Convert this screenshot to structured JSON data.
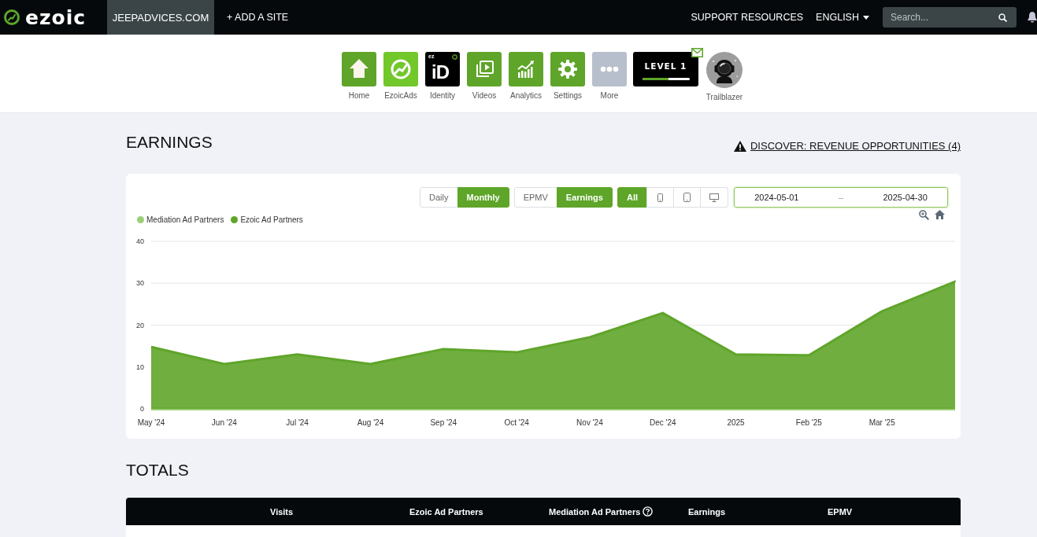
{
  "topbar": {
    "logo": "ezoic",
    "site_tab": {
      "label": "JEEPADVICES.COM",
      "selected": true
    },
    "add_site": "+ ADD A SITE",
    "support": "SUPPORT RESOURCES",
    "language": "ENGLISH",
    "search": {
      "placeholder": "Search..."
    }
  },
  "apps": [
    {
      "kind": "tile",
      "label": "Home"
    },
    {
      "kind": "tile",
      "label": "EzoicAds"
    },
    {
      "kind": "logo_tile",
      "label": "Identity",
      "logo_small": "ez",
      "logo_large": "iD"
    },
    {
      "kind": "tile",
      "label": "Videos"
    },
    {
      "kind": "tile",
      "label": "Analytics"
    },
    {
      "kind": "tile",
      "label": "Settings"
    },
    {
      "kind": "tile",
      "label": "More"
    },
    {
      "kind": "level",
      "title": "LEVEL 1",
      "level": 0.56
    },
    {
      "kind": "avatar",
      "label": "Trailblazer"
    }
  ],
  "earnings": {
    "title": "EARNINGS",
    "discover_link": "DISCOVER: REVENUE OPPORTUNITIES (4)",
    "period_buttons": [
      {
        "label": "Daily",
        "selected": false
      },
      {
        "label": "Monthly",
        "selected": true
      }
    ],
    "metric_buttons": [
      {
        "label": "EPMV",
        "selected": false
      },
      {
        "label": "Earnings",
        "selected": true
      }
    ],
    "device_buttons": [
      {
        "kind": "text",
        "label": "All",
        "selected": true
      },
      {
        "kind": "phone",
        "selected": false
      },
      {
        "kind": "tablet",
        "selected": false
      },
      {
        "kind": "desktop",
        "selected": false
      }
    ],
    "date_range": {
      "start": "2024-05-01",
      "separator": "–",
      "end": "2025-04-30"
    },
    "chart_data": {
      "type": "area",
      "categories": [
        "May '24",
        "Jun '24",
        "Jul '24",
        "Aug '24",
        "Sep '24",
        "Oct '24",
        "Nov '24",
        "Dec '24",
        "2025",
        "Feb '25",
        "Mar '25",
        null
      ],
      "ylim": [
        0,
        40
      ],
      "yticks": [
        0,
        10,
        20,
        30,
        40
      ],
      "series": [
        {
          "name": "Mediation Ad Partners",
          "color": "#9ccf76",
          "values": [
            0,
            0,
            0,
            0,
            0,
            0,
            0,
            0,
            0,
            0,
            0,
            0
          ]
        },
        {
          "name": "Ezoic Ad Partners",
          "color": "#5fa52a",
          "values": [
            14.8,
            10.7,
            13.0,
            10.7,
            14.3,
            13.5,
            17.1,
            22.9,
            13.0,
            12.8,
            23.3,
            30.4
          ]
        }
      ]
    }
  },
  "totals": {
    "title": "TOTALS",
    "columns": [
      {
        "label": "Visits",
        "help": false
      },
      {
        "label": "Ezoic Ad Partners",
        "help": false
      },
      {
        "label": "Mediation Ad Partners",
        "help": true
      },
      {
        "label": "Earnings",
        "help": false
      },
      {
        "label": "EPMV",
        "help": false
      }
    ]
  }
}
